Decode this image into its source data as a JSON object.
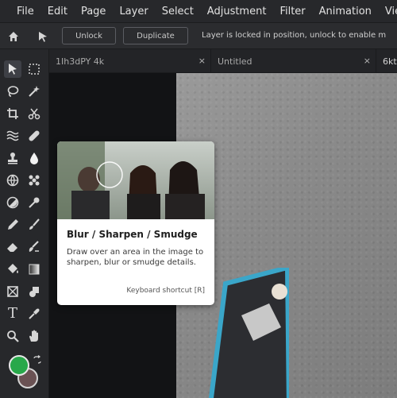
{
  "menu": [
    "File",
    "Edit",
    "Page",
    "Layer",
    "Select",
    "Adjustment",
    "Filter",
    "Animation",
    "View"
  ],
  "options": {
    "unlock_label": "Unlock",
    "duplicate_label": "Duplicate",
    "hint": "Layer is locked in position, unlock to enable m"
  },
  "tabs": [
    {
      "label": "1Ih3dPY 4k",
      "close": "×"
    },
    {
      "label": "Untitled",
      "close": "×"
    },
    {
      "label": "6kt"
    }
  ],
  "tooltip": {
    "title": "Blur / Sharpen / Smudge",
    "description": "Draw over an area in the image to sharpen, blur or smudge details.",
    "shortcut": "Keyboard shortcut [R]"
  },
  "tools": [
    "select-arrow-icon",
    "marquee-icon",
    "lasso-icon",
    "magic-wand-icon",
    "crop-icon",
    "scissors-icon",
    "liquify-icon",
    "healing-icon",
    "stamp-icon",
    "blur-drop-icon",
    "globe-icon",
    "pattern-icon",
    "sponge-icon",
    "dodge-icon",
    "pencil-icon",
    "brush-icon",
    "eraser-icon",
    "smudge-brush-icon",
    "bucket-icon",
    "gradient-icon",
    "frame-icon",
    "shape-icon",
    "text-icon",
    "eyedropper-icon",
    "zoom-icon",
    "hand-icon"
  ],
  "colors": {
    "foreground": "#28a84a",
    "background": "#6a5254",
    "accent": "#3e4046"
  }
}
